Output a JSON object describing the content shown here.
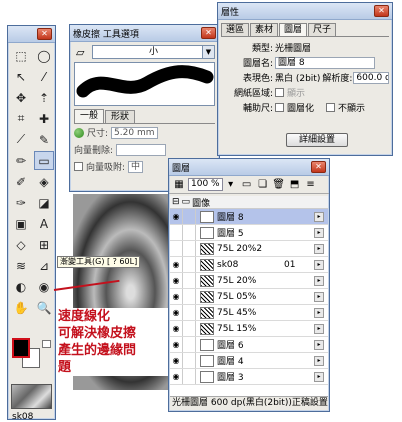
{
  "toolbox": {
    "thumb_label": "sk08"
  },
  "tooltip": {
    "text": "漸變工具(G) [ ? 60L]"
  },
  "annotation": {
    "text": "速度線化\n可解決橡皮擦\n產生的邊緣問\n題"
  },
  "eraser": {
    "title": "橡皮擦 工具選項",
    "preset_value": "小",
    "tabs": [
      "一般",
      "形狀"
    ],
    "size_label": "尺寸:",
    "size_value": "5.20",
    "size_unit": "mm",
    "vector_erase_label": "向量刪除:",
    "vector_snap_label": "向量吸附:",
    "vector_snap_value": "中"
  },
  "props": {
    "title": "層性",
    "tabs": [
      "選區",
      "素材",
      "圖層",
      "尺子"
    ],
    "active_tab": "圖層",
    "type_label": "類型:",
    "type_value": "光柵圖層",
    "name_label": "圖層名:",
    "name_value": "圖層 8",
    "color_label": "表現色:",
    "color_value": "黑白 (2bit)",
    "resolution_label": "解析度:",
    "resolution_value": "600.0 dp",
    "grid_label": "網紙區域:",
    "grid_option": "顯示",
    "ruler_label": "輔助尺:",
    "ruler_option1": "圖層化",
    "ruler_option2": "不顯示",
    "detail_button": "詳細設置"
  },
  "layers": {
    "title": "圖層",
    "zoom": "100 %",
    "group_name": "圖像",
    "rows": [
      {
        "name": "圖層 8",
        "extra": "",
        "eye": true,
        "selected": true,
        "pattern": false
      },
      {
        "name": "圖層 5",
        "extra": "",
        "eye": false,
        "selected": false,
        "pattern": false
      },
      {
        "name": "75L 20%2",
        "extra": "",
        "eye": false,
        "selected": false,
        "pattern": true
      },
      {
        "name": "sk08",
        "extra": "01",
        "eye": true,
        "selected": false,
        "pattern": true
      },
      {
        "name": "75L 20%",
        "extra": "",
        "eye": true,
        "selected": false,
        "pattern": true
      },
      {
        "name": "75L 05%",
        "extra": "",
        "eye": true,
        "selected": false,
        "pattern": true
      },
      {
        "name": "75L 45%",
        "extra": "",
        "eye": true,
        "selected": false,
        "pattern": true
      },
      {
        "name": "75L 15%",
        "extra": "",
        "eye": true,
        "selected": false,
        "pattern": true
      },
      {
        "name": "圖層 6",
        "extra": "",
        "eye": true,
        "selected": false,
        "pattern": false
      },
      {
        "name": "圖層 4",
        "extra": "",
        "eye": true,
        "selected": false,
        "pattern": false
      },
      {
        "name": "圖層 3",
        "extra": "",
        "eye": true,
        "selected": false,
        "pattern": false
      }
    ],
    "status": "光柵圖層 600 dp(黑白(2bit))正稿設置"
  },
  "colors": {
    "accent_red": "#c4111d",
    "selection": "#b4c3ea"
  }
}
